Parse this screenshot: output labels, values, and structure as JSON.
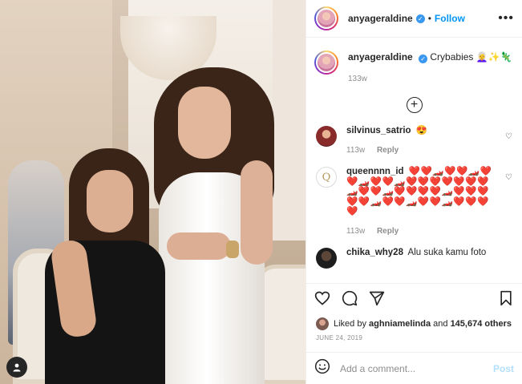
{
  "header": {
    "username": "anyageraldine",
    "separator": "•",
    "follow_label": "Follow",
    "more_label": "•••"
  },
  "caption": {
    "username": "anyageraldine",
    "text": "Crybabies 👩‍🦳✨🦎",
    "time": "133w"
  },
  "load_more_label": "+",
  "comments": [
    {
      "username": "silvinus_satrio",
      "text": "😍",
      "time": "113w",
      "reply_label": "Reply"
    },
    {
      "username": "queennnn_id",
      "text": "❤️❤️🏎️❤️❤️🏎️❤️❤️🏎️❤️❤️🏎️❤️❤️❤️❤️❤️❤️❤️🏎️❤️❤️🏎️❤️❤️❤️❤️🏎️❤️❤️❤️❤️❤️🏎️❤️❤️🏎️❤️❤️🏎️❤️❤️❤️❤️",
      "time": "113w",
      "reply_label": "Reply",
      "avatar_letter": "Q"
    },
    {
      "username": "chika_why28",
      "text": "Alu suka kamu foto",
      "time": "",
      "reply_label": ""
    }
  ],
  "actions": {
    "like_icon": "heart-icon",
    "comment_icon": "comment-icon",
    "share_icon": "share-icon",
    "save_icon": "bookmark-icon"
  },
  "likes": {
    "prefix": "Liked by",
    "user": "aghniamelinda",
    "middle": "and",
    "count": "145,674 others"
  },
  "date": "JUNE 24, 2019",
  "add_comment": {
    "placeholder": "Add a comment...",
    "post_label": "Post"
  },
  "colors": {
    "link_blue": "#0095f6",
    "post_disabled": "#b2dffc",
    "verified": "#3897f0",
    "muted": "#8e8e8e"
  }
}
